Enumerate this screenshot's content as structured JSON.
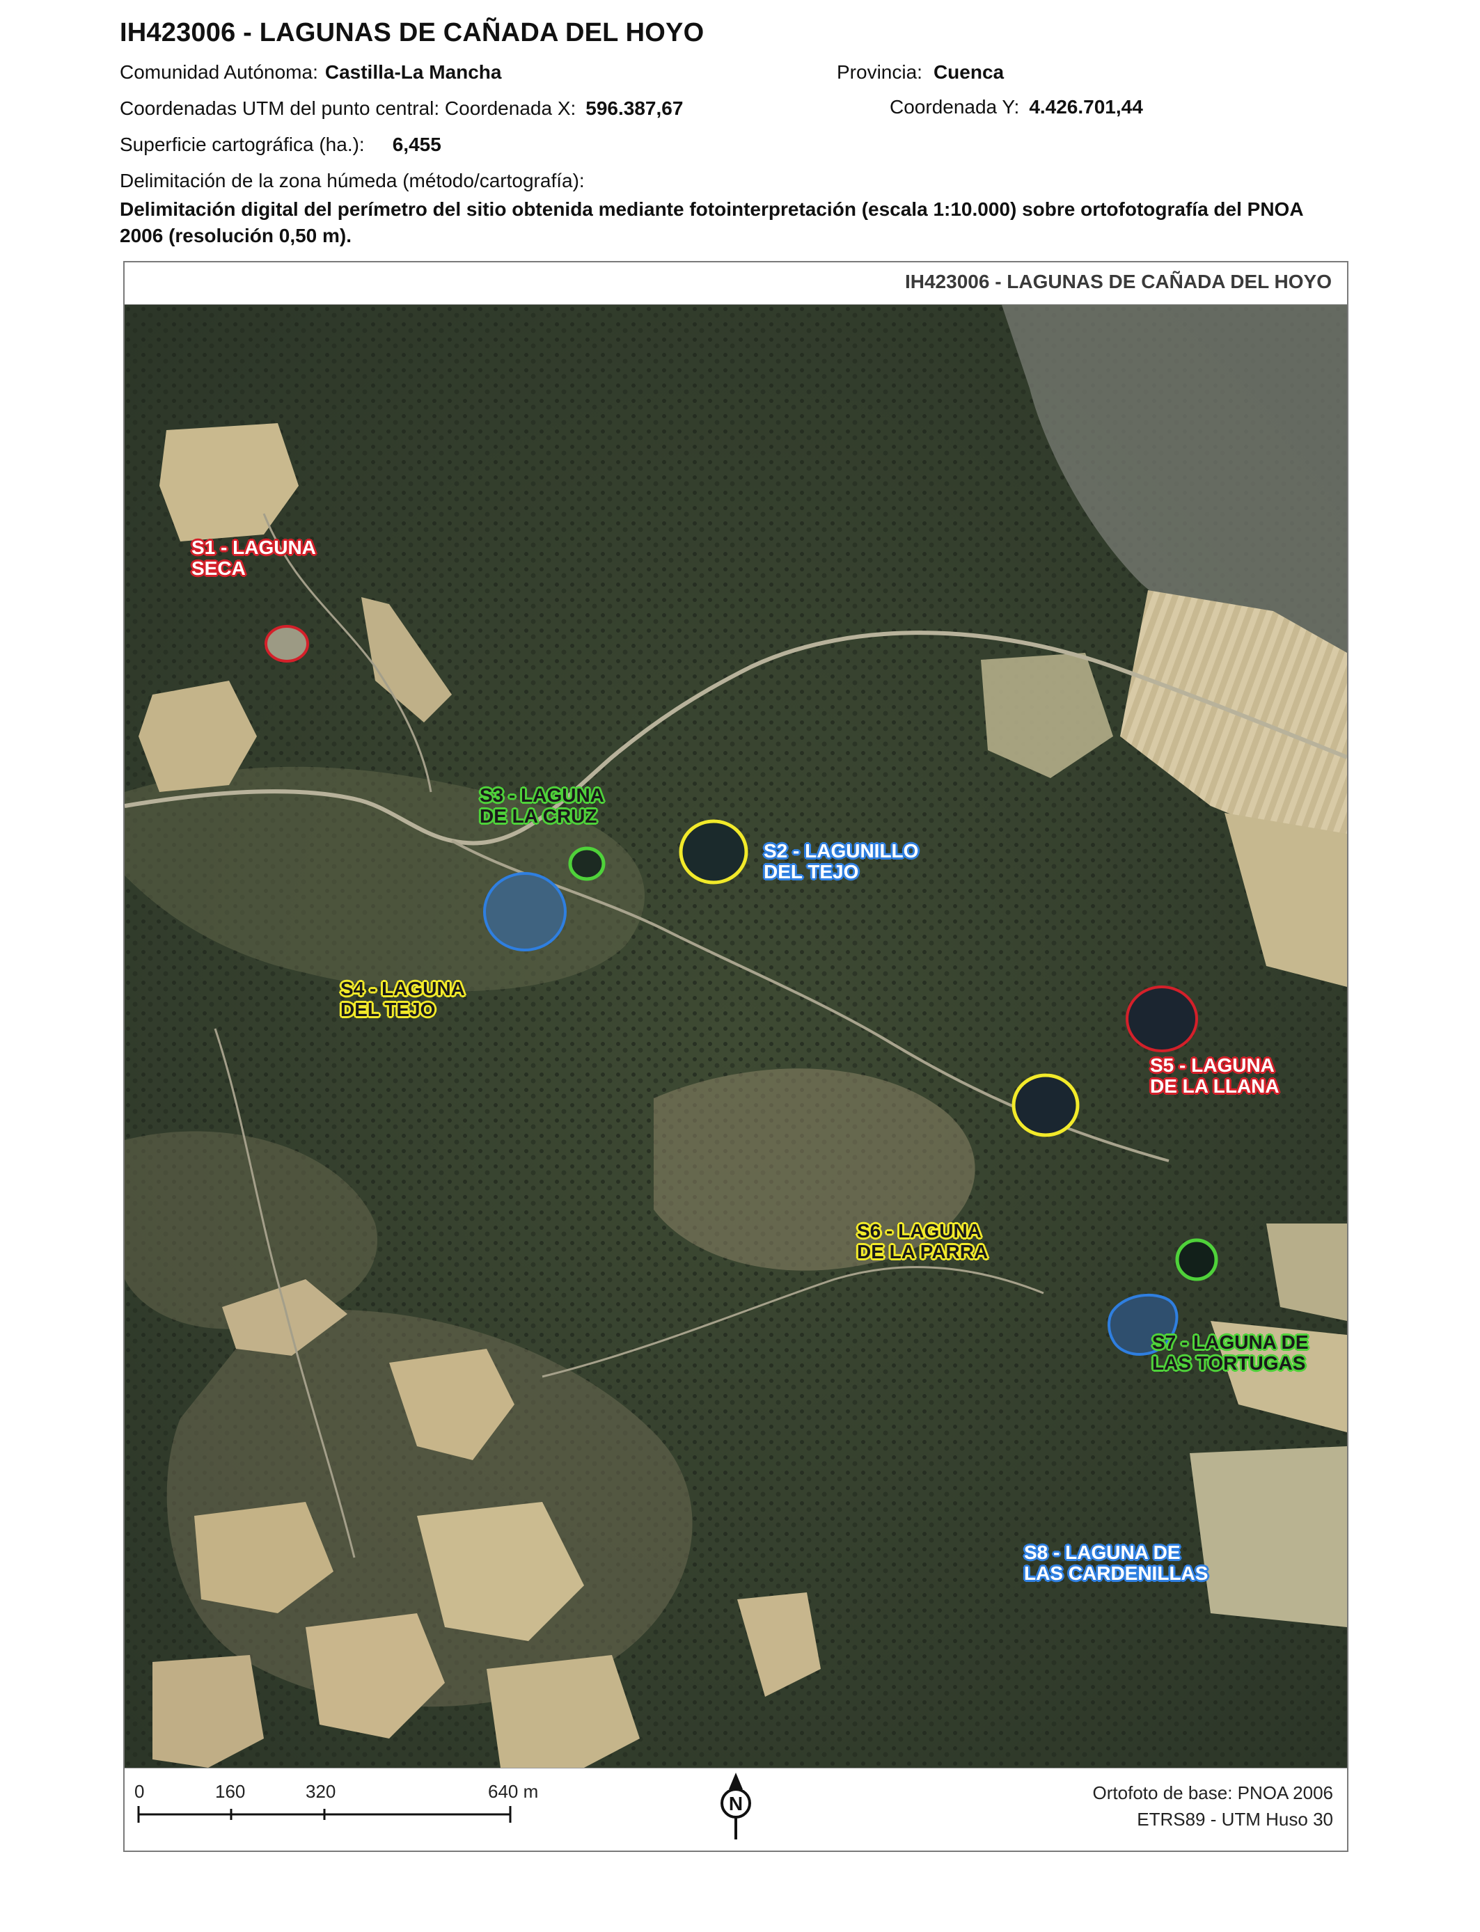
{
  "header": {
    "title": "IH423006 - LAGUNAS DE CAÑADA DEL HOYO",
    "comunidad_label": "Comunidad Autónoma:",
    "comunidad_value": "Castilla-La Mancha",
    "provincia_label": "Provincia:",
    "provincia_value": "Cuenca",
    "utm_label": "Coordenadas UTM del punto central: Coordenada X:",
    "utm_x": "596.387,67",
    "utm_y_label": "Coordenada Y:",
    "utm_y": "4.426.701,44",
    "superficie_label": "Superficie cartográfica (ha.):",
    "superficie_value": "6,455",
    "delimitacion_label": "Delimitación de la zona húmeda (método/cartografía):",
    "delimitacion_text": "Delimitación digital del perímetro del sitio obtenida mediante fotointerpretación (escala 1:10.000) sobre ortofotografía del PNOA 2006 (resolución 0,50 m)."
  },
  "map": {
    "title": "IH423006 - LAGUNAS DE CAÑADA DEL HOYO",
    "colors": {
      "red": "#d4202a",
      "green": "#4fd23a",
      "yellow": "#f2ea2a",
      "blue": "#2f7fe0"
    },
    "sites": [
      {
        "id": "S1",
        "line1": "S1 - LAGUNA",
        "line2": "SECA",
        "color": "red"
      },
      {
        "id": "S2",
        "line1": "S2 - LAGUNILLO",
        "line2": "DEL TEJO",
        "color": "blue"
      },
      {
        "id": "S3",
        "line1": "S3 - LAGUNA",
        "line2": "DE LA CRUZ",
        "color": "green"
      },
      {
        "id": "S4",
        "line1": "S4 - LAGUNA",
        "line2": "DEL TEJO",
        "color": "yellow"
      },
      {
        "id": "S5",
        "line1": "S5 - LAGUNA",
        "line2": "DE LA LLANA",
        "color": "red"
      },
      {
        "id": "S6",
        "line1": "S6 - LAGUNA",
        "line2": "DE LA PARRA",
        "color": "yellow"
      },
      {
        "id": "S7",
        "line1": "S7 - LAGUNA DE",
        "line2": "LAS TORTUGAS",
        "color": "green"
      },
      {
        "id": "S8",
        "line1": "S8 - LAGUNA DE",
        "line2": "LAS CARDENILLAS",
        "color": "blue"
      }
    ]
  },
  "footer": {
    "scale_ticks": [
      "0",
      "160",
      "320",
      "640 m"
    ],
    "north_label": "N",
    "credit_line1": "Ortofoto de base: PNOA 2006",
    "credit_line2": "ETRS89 - UTM Huso 30"
  }
}
